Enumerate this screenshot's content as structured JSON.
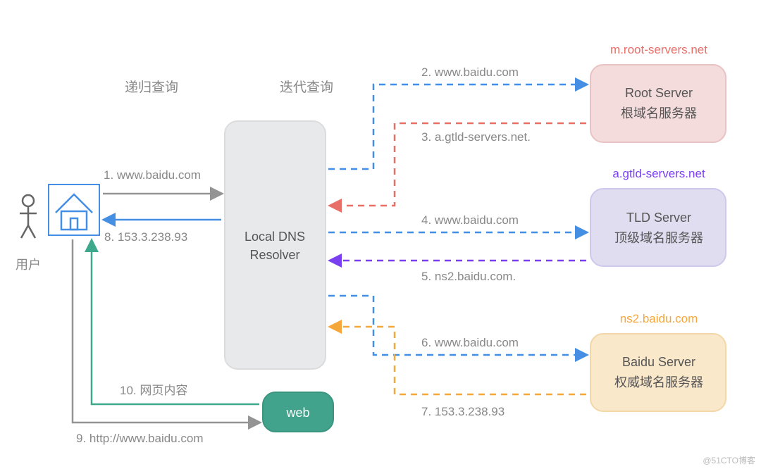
{
  "headers": {
    "recursive": "递归查询",
    "iterative": "迭代查询"
  },
  "nodes": {
    "user": "用户",
    "resolver_l1": "Local DNS",
    "resolver_l2": "Resolver",
    "web": "web",
    "root_l1": "Root Server",
    "root_l2": "根域名服务器",
    "root_domain": "m.root-servers.net",
    "tld_l1": "TLD Server",
    "tld_l2": "顶级域名服务器",
    "tld_domain": "a.gtld-servers.net",
    "auth_l1": "Baidu Server",
    "auth_l2": "权威域名服务器",
    "auth_domain": "ns2.baidu.com"
  },
  "steps": {
    "s1": "1. www.baidu.com",
    "s2": "2. www.baidu.com",
    "s3": "3.  a.gtld-servers.net.",
    "s4": "4. www.baidu.com",
    "s5": "5. ns2.baidu.com.",
    "s6": "6. www.baidu.com",
    "s7": "7. 153.3.238.93",
    "s8": "8. 153.3.238.93",
    "s9": "9. http://www.baidu.com",
    "s10": "10. 网页内容"
  },
  "colors": {
    "gray": "#949494",
    "blue": "#448EE3",
    "red": "#E86E68",
    "purple": "#7B3FF2",
    "lilac": "#B6A0E0",
    "orange": "#F5A73A",
    "teal": "#3EA88D",
    "root_fill": "#F4DCDC",
    "root_border": "#E9C3C3",
    "tld_fill": "#E0DDF1",
    "tld_border": "#CFC8EC",
    "auth_fill": "#FAE8CB",
    "auth_border": "#F3D7A8",
    "resolver_fill": "#E8E9EB",
    "resolver_border": "#DBDCDE",
    "web_fill": "#42A38C",
    "web_border": "#3A9580"
  },
  "watermark": "@51CTO博客"
}
